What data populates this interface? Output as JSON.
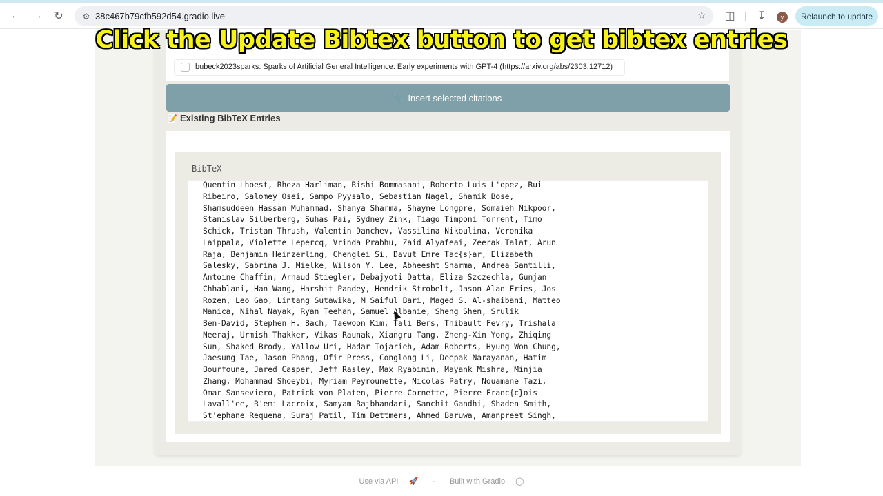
{
  "browser": {
    "url": "38c467b79cfb592d54.gradio.live",
    "relaunch_label": "Relaunch to update",
    "avatar_letter": "y"
  },
  "caption": "Click the Update Bibtex button to get bibtex entries",
  "citation": {
    "label": "bubeck2023sparks: Sparks of Artificial General Intelligence: Early experiments with GPT-4 (https://arxiv.org/abs/2303.12712)"
  },
  "insert_button": "Insert selected citations",
  "section_title": "Existing BibTeX Entries",
  "bibtex": {
    "label": "BibTeX",
    "lines": [
      "Quentin Lhoest, Rheza Harliman, Rishi Bommasani, Roberto Luis L'opez, Rui",
      "Ribeiro, Salomey Osei, Sampo Pyysalo, Sebastian Nagel, Shamik Bose,",
      "Shamsuddeen Hassan Muhammad, Shanya Sharma, Shayne Longpre, Somaieh Nikpoor,",
      "Stanislav Silberberg, Suhas Pai, Sydney Zink, Tiago Timponi Torrent, Timo",
      "Schick, Tristan Thrush, Valentin Danchev, Vassilina Nikoulina, Veronika",
      "Laippala, Violette Lepercq, Vrinda Prabhu, Zaid Alyafeai, Zeerak Talat, Arun",
      "Raja, Benjamin Heinzerling, Chenglei Si, Davut Emre Tac{s}ar, Elizabeth",
      "Salesky, Sabrina J. Mielke, Wilson Y. Lee, Abheesht Sharma, Andrea Santilli,",
      "Antoine Chaffin, Arnaud Stiegler, Debajyoti Datta, Eliza Szczechla, Gunjan",
      "Chhablani, Han Wang, Harshit Pandey, Hendrik Strobelt, Jason Alan Fries, Jos",
      "Rozen, Leo Gao, Lintang Sutawika, M Saiful Bari, Maged S. Al-shaibani, Matteo",
      "Manica, Nihal Nayak, Ryan Teehan, Samuel Albanie, Sheng Shen, Srulik",
      "Ben-David, Stephen H. Bach, Taewoon Kim, Tali Bers, Thibault Fevry, Trishala",
      "Neeraj, Urmish Thakker, Vikas Raunak, Xiangru Tang, Zheng-Xin Yong, Zhiqing",
      "Sun, Shaked Brody, Yallow Uri, Hadar Tojarieh, Adam Roberts, Hyung Won Chung,",
      "Jaesung Tae, Jason Phang, Ofir Press, Conglong Li, Deepak Narayanan, Hatim",
      "Bourfoune, Jared Casper, Jeff Rasley, Max Ryabinin, Mayank Mishra, Minjia",
      "Zhang, Mohammad Shoeybi, Myriam Peyrounette, Nicolas Patry, Nouamane Tazi,",
      "Omar Sanseviero, Patrick von Platen, Pierre Cornette, Pierre Franc{c}ois",
      "Lavall'ee, R'emi Lacroix, Samyam Rajbhandari, Sanchit Gandhi, Shaden Smith,",
      "St'ephane Requena, Suraj Patil, Tim Dettmers, Ahmed Baruwa, Amanpreet Singh,"
    ]
  },
  "footer": {
    "api": "Use via API",
    "built": "Built with Gradio"
  }
}
